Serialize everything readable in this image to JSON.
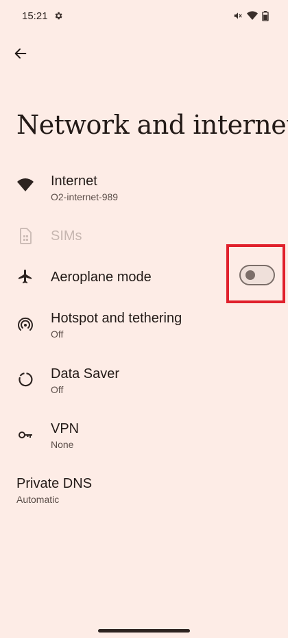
{
  "status_bar": {
    "time": "15:21",
    "icons": [
      "gear-icon",
      "mute-icon",
      "wifi-icon",
      "battery-icon"
    ]
  },
  "header": {
    "back_icon": "arrow-left-icon",
    "title": "Network and internet"
  },
  "items": [
    {
      "icon": "wifi-icon",
      "title": "Internet",
      "subtitle": "O2-internet-989",
      "enabled": true
    },
    {
      "icon": "sim-card-icon",
      "title": "SIMs",
      "enabled": false
    },
    {
      "icon": "airplane-icon",
      "title": "Aeroplane mode",
      "toggle_on": false,
      "enabled": true
    },
    {
      "icon": "hotspot-icon",
      "title": "Hotspot and tethering",
      "subtitle": "Off",
      "enabled": true
    },
    {
      "icon": "data-saver-icon",
      "title": "Data Saver",
      "subtitle": "Off",
      "enabled": true
    },
    {
      "icon": "vpn-key-icon",
      "title": "VPN",
      "subtitle": "None",
      "enabled": true
    },
    {
      "title": "Private DNS",
      "subtitle": "Automatic",
      "enabled": true
    }
  ],
  "colors": {
    "background": "#fdece6",
    "text": "#231a17",
    "highlight": "#e0202c"
  }
}
